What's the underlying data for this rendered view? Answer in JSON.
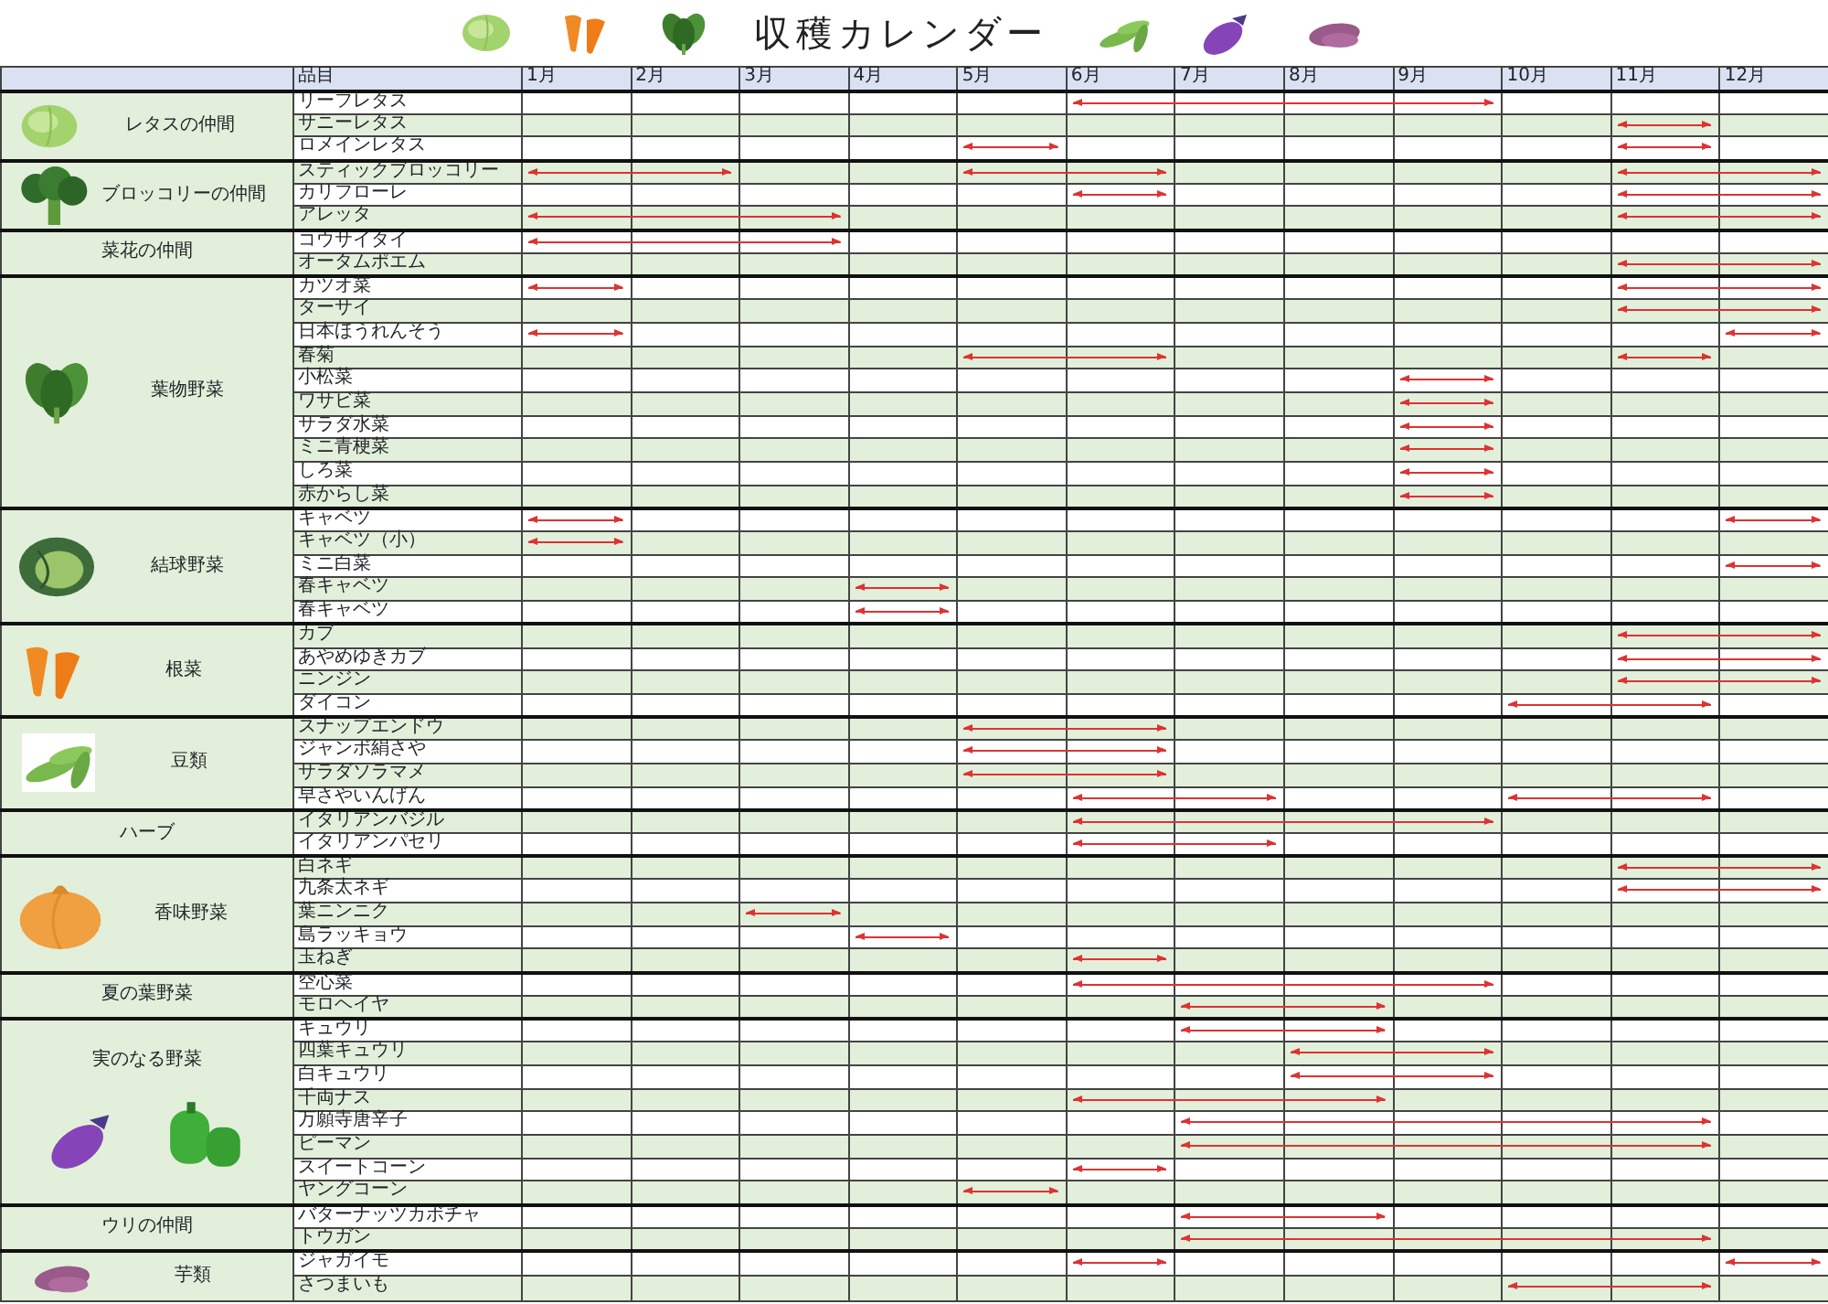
{
  "title": "収穫カレンダー",
  "item_heading": "品目",
  "months": [
    "1月",
    "2月",
    "3月",
    "4月",
    "5月",
    "6月",
    "7月",
    "8月",
    "9月",
    "10月",
    "11月",
    "12月"
  ],
  "groups": [
    {
      "label": "レタスの仲間",
      "items": [
        {
          "name": "リーフレタス",
          "harvest": [
            false,
            false,
            false,
            false,
            false,
            true,
            true,
            true,
            true,
            false,
            false,
            false
          ]
        },
        {
          "name": "サニーレタス",
          "harvest": [
            false,
            false,
            false,
            false,
            false,
            false,
            false,
            false,
            false,
            false,
            true,
            false
          ]
        },
        {
          "name": "ロメインレタス",
          "harvest": [
            false,
            false,
            false,
            false,
            true,
            false,
            false,
            false,
            false,
            false,
            true,
            false
          ]
        }
      ]
    },
    {
      "label": "ブロッコリーの仲間",
      "items": [
        {
          "name": "スティックブロッコリー",
          "harvest": [
            true,
            true,
            false,
            false,
            true,
            true,
            false,
            false,
            false,
            false,
            true,
            true
          ]
        },
        {
          "name": "カリフローレ",
          "harvest": [
            false,
            false,
            false,
            false,
            false,
            true,
            false,
            false,
            false,
            false,
            true,
            true
          ]
        },
        {
          "name": "アレッタ",
          "harvest": [
            true,
            true,
            true,
            false,
            false,
            false,
            false,
            false,
            false,
            false,
            true,
            true
          ]
        }
      ]
    },
    {
      "label": "菜花の仲間",
      "items": [
        {
          "name": "コウサイタイ",
          "harvest": [
            true,
            true,
            true,
            false,
            false,
            false,
            false,
            false,
            false,
            false,
            false,
            false
          ]
        },
        {
          "name": "オータムポエム",
          "harvest": [
            false,
            false,
            false,
            false,
            false,
            false,
            false,
            false,
            false,
            false,
            true,
            true
          ]
        }
      ]
    },
    {
      "label": "葉物野菜",
      "items": [
        {
          "name": "カツオ菜",
          "harvest": [
            true,
            false,
            false,
            false,
            false,
            false,
            false,
            false,
            false,
            false,
            true,
            true
          ]
        },
        {
          "name": "ターサイ",
          "harvest": [
            false,
            false,
            false,
            false,
            false,
            false,
            false,
            false,
            false,
            false,
            true,
            true
          ]
        },
        {
          "name": "日本ほうれんそう",
          "harvest": [
            true,
            false,
            false,
            false,
            false,
            false,
            false,
            false,
            false,
            false,
            false,
            true
          ]
        },
        {
          "name": "春菊",
          "harvest": [
            false,
            false,
            false,
            false,
            true,
            true,
            false,
            false,
            false,
            false,
            true,
            false
          ]
        },
        {
          "name": "小松菜",
          "harvest": [
            false,
            false,
            false,
            false,
            false,
            false,
            false,
            false,
            true,
            false,
            false,
            false
          ]
        },
        {
          "name": "ワサビ菜",
          "harvest": [
            false,
            false,
            false,
            false,
            false,
            false,
            false,
            false,
            true,
            false,
            false,
            false
          ]
        },
        {
          "name": "サラダ水菜",
          "harvest": [
            false,
            false,
            false,
            false,
            false,
            false,
            false,
            false,
            true,
            false,
            false,
            false
          ]
        },
        {
          "name": "ミニ青梗菜",
          "harvest": [
            false,
            false,
            false,
            false,
            false,
            false,
            false,
            false,
            true,
            false,
            false,
            false
          ]
        },
        {
          "name": "しろ菜",
          "harvest": [
            false,
            false,
            false,
            false,
            false,
            false,
            false,
            false,
            true,
            false,
            false,
            false
          ]
        },
        {
          "name": "赤からし菜",
          "harvest": [
            false,
            false,
            false,
            false,
            false,
            false,
            false,
            false,
            true,
            false,
            false,
            false
          ]
        }
      ]
    },
    {
      "label": "結球野菜",
      "items": [
        {
          "name": "キャベツ",
          "harvest": [
            true,
            false,
            false,
            false,
            false,
            false,
            false,
            false,
            false,
            false,
            false,
            true
          ]
        },
        {
          "name": "キャベツ（小）",
          "harvest": [
            true,
            false,
            false,
            false,
            false,
            false,
            false,
            false,
            false,
            false,
            false,
            false
          ]
        },
        {
          "name": "ミニ白菜",
          "harvest": [
            false,
            false,
            false,
            false,
            false,
            false,
            false,
            false,
            false,
            false,
            false,
            true
          ]
        },
        {
          "name": "春キャベツ",
          "harvest": [
            false,
            false,
            false,
            true,
            false,
            false,
            false,
            false,
            false,
            false,
            false,
            false
          ]
        },
        {
          "name": "春キャベツ",
          "harvest": [
            false,
            false,
            false,
            true,
            false,
            false,
            false,
            false,
            false,
            false,
            false,
            false
          ]
        }
      ]
    },
    {
      "label": "根菜",
      "items": [
        {
          "name": "カブ",
          "harvest": [
            false,
            false,
            false,
            false,
            false,
            false,
            false,
            false,
            false,
            false,
            true,
            true
          ]
        },
        {
          "name": "あやめゆきカブ",
          "harvest": [
            false,
            false,
            false,
            false,
            false,
            false,
            false,
            false,
            false,
            false,
            true,
            true
          ]
        },
        {
          "name": "ニンジン",
          "harvest": [
            false,
            false,
            false,
            false,
            false,
            false,
            false,
            false,
            false,
            false,
            true,
            true
          ]
        },
        {
          "name": "ダイコン",
          "harvest": [
            false,
            false,
            false,
            false,
            false,
            false,
            false,
            false,
            false,
            true,
            true,
            false
          ]
        }
      ]
    },
    {
      "label": "豆類",
      "items": [
        {
          "name": "スナップエンドウ",
          "harvest": [
            false,
            false,
            false,
            false,
            true,
            true,
            false,
            false,
            false,
            false,
            false,
            false
          ]
        },
        {
          "name": "ジャンボ絹さや",
          "harvest": [
            false,
            false,
            false,
            false,
            true,
            true,
            false,
            false,
            false,
            false,
            false,
            false
          ]
        },
        {
          "name": "サラダソラマメ",
          "harvest": [
            false,
            false,
            false,
            false,
            true,
            true,
            false,
            false,
            false,
            false,
            false,
            false
          ]
        },
        {
          "name": "早さやいんげん",
          "harvest": [
            false,
            false,
            false,
            false,
            false,
            true,
            true,
            false,
            false,
            true,
            true,
            false
          ]
        }
      ]
    },
    {
      "label": "ハーブ",
      "items": [
        {
          "name": "イタリアンバジル",
          "harvest": [
            false,
            false,
            false,
            false,
            false,
            true,
            true,
            true,
            true,
            false,
            false,
            false
          ]
        },
        {
          "name": "イタリアンパセリ",
          "harvest": [
            false,
            false,
            false,
            false,
            false,
            true,
            true,
            false,
            false,
            false,
            false,
            false
          ]
        }
      ]
    },
    {
      "label": "香味野菜",
      "items": [
        {
          "name": "白ネギ",
          "harvest": [
            false,
            false,
            false,
            false,
            false,
            false,
            false,
            false,
            false,
            false,
            true,
            true
          ]
        },
        {
          "name": "九条太ネギ",
          "harvest": [
            false,
            false,
            false,
            false,
            false,
            false,
            false,
            false,
            false,
            false,
            true,
            true
          ]
        },
        {
          "name": "葉ニンニク",
          "harvest": [
            false,
            false,
            true,
            false,
            false,
            false,
            false,
            false,
            false,
            false,
            false,
            false
          ]
        },
        {
          "name": "島ラッキョウ",
          "harvest": [
            false,
            false,
            false,
            true,
            false,
            false,
            false,
            false,
            false,
            false,
            false,
            false
          ]
        },
        {
          "name": "玉ねぎ",
          "harvest": [
            false,
            false,
            false,
            false,
            false,
            true,
            false,
            false,
            false,
            false,
            false,
            false
          ]
        }
      ]
    },
    {
      "label": "夏の葉野菜",
      "items": [
        {
          "name": "空心菜",
          "harvest": [
            false,
            false,
            false,
            false,
            false,
            true,
            true,
            true,
            true,
            false,
            false,
            false
          ]
        },
        {
          "name": "モロヘイヤ",
          "harvest": [
            false,
            false,
            false,
            false,
            false,
            false,
            true,
            true,
            false,
            false,
            false,
            false
          ]
        }
      ]
    },
    {
      "label": "実のなる野菜",
      "items": [
        {
          "name": "キュウリ",
          "harvest": [
            false,
            false,
            false,
            false,
            false,
            false,
            true,
            true,
            false,
            false,
            false,
            false
          ]
        },
        {
          "name": "四葉キュウリ",
          "harvest": [
            false,
            false,
            false,
            false,
            false,
            false,
            false,
            true,
            true,
            false,
            false,
            false
          ]
        },
        {
          "name": "白キュウリ",
          "harvest": [
            false,
            false,
            false,
            false,
            false,
            false,
            false,
            true,
            true,
            false,
            false,
            false
          ]
        },
        {
          "name": "千両ナス",
          "harvest": [
            false,
            false,
            false,
            false,
            false,
            true,
            true,
            true,
            false,
            false,
            false,
            false
          ]
        },
        {
          "name": "万願寺唐辛子",
          "harvest": [
            false,
            false,
            false,
            false,
            false,
            false,
            true,
            true,
            true,
            true,
            true,
            false
          ]
        },
        {
          "name": "ピーマン",
          "harvest": [
            false,
            false,
            false,
            false,
            false,
            false,
            true,
            true,
            true,
            true,
            true,
            false
          ]
        },
        {
          "name": "スイートコーン",
          "harvest": [
            false,
            false,
            false,
            false,
            false,
            true,
            false,
            false,
            false,
            false,
            false,
            false
          ]
        },
        {
          "name": "ヤングコーン",
          "harvest": [
            false,
            false,
            false,
            false,
            true,
            false,
            false,
            false,
            false,
            false,
            false,
            false
          ]
        }
      ]
    },
    {
      "label": "ウリの仲間",
      "items": [
        {
          "name": "バターナッツカボチャ",
          "harvest": [
            false,
            false,
            false,
            false,
            false,
            false,
            true,
            true,
            false,
            false,
            false,
            false
          ]
        },
        {
          "name": "トウガン",
          "harvest": [
            false,
            false,
            false,
            false,
            false,
            false,
            true,
            true,
            true,
            true,
            true,
            false
          ]
        }
      ]
    },
    {
      "label": "芋類",
      "items": [
        {
          "name": "ジャガイモ",
          "harvest": [
            false,
            false,
            false,
            false,
            false,
            true,
            false,
            false,
            false,
            false,
            false,
            true
          ]
        },
        {
          "name": "さつまいも",
          "harvest": [
            false,
            false,
            false,
            false,
            false,
            false,
            false,
            false,
            false,
            true,
            true,
            false
          ]
        }
      ]
    }
  ]
}
